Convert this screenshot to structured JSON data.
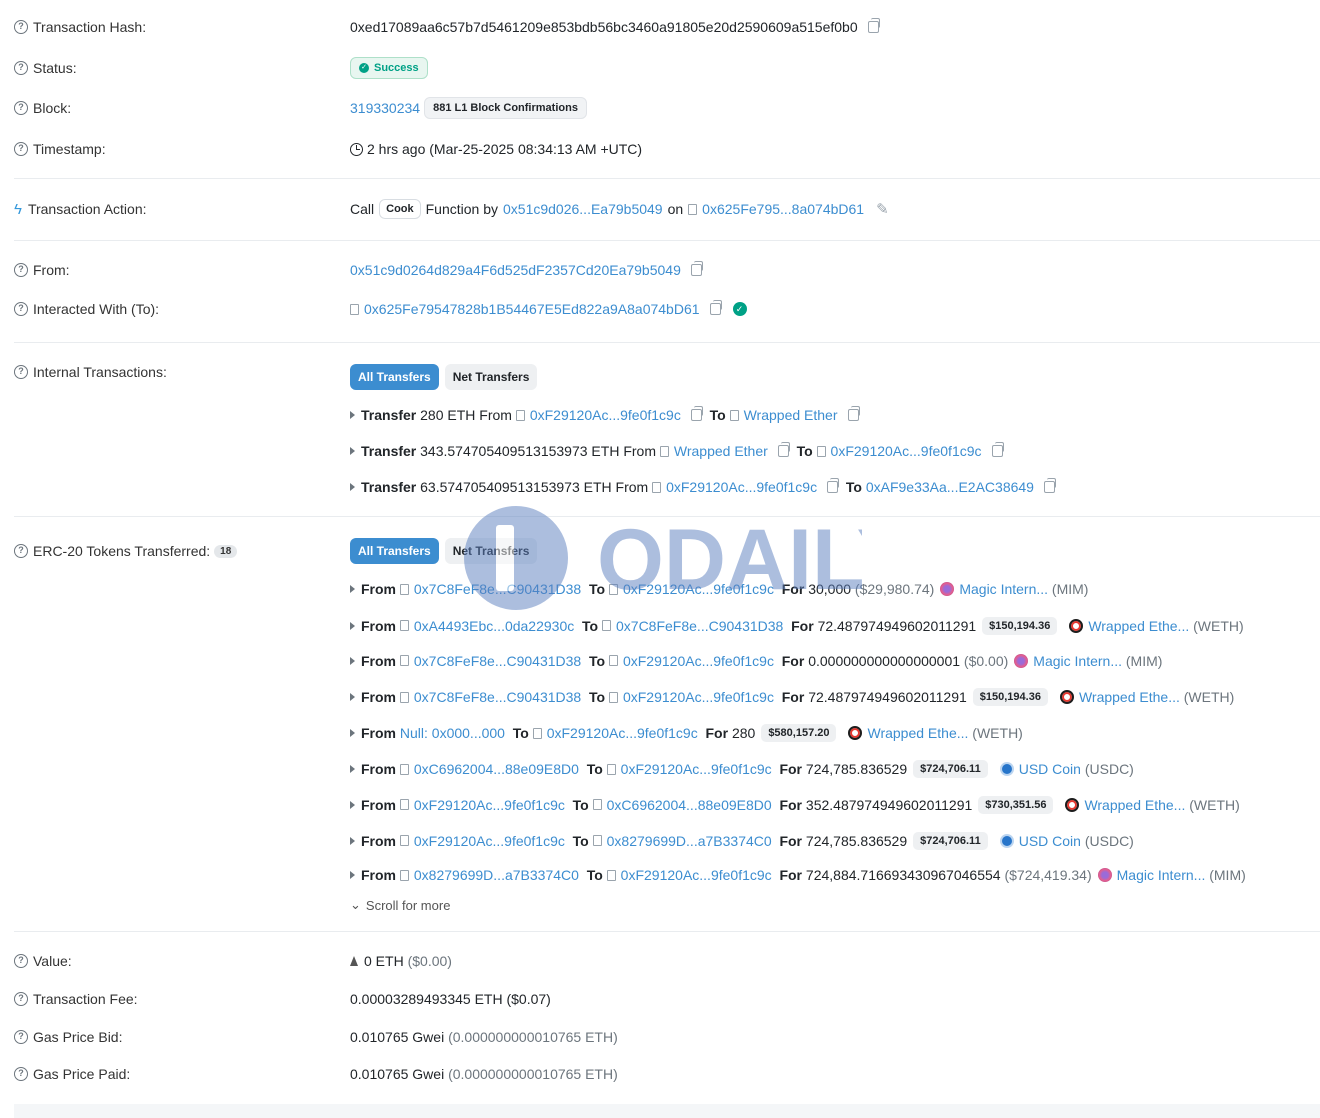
{
  "tx_hash": {
    "label": "Transaction Hash:",
    "value": "0xed17089aa6c57b7d5461209e853bdb56bc3460a91805e20d2590609a515ef0b0"
  },
  "status": {
    "label": "Status:",
    "value": "Success"
  },
  "block": {
    "label": "Block:",
    "number": "319330234",
    "confirmations": "881 L1 Block Confirmations"
  },
  "timestamp": {
    "label": "Timestamp:",
    "value": "2 hrs ago (Mar-25-2025 08:34:13 AM +UTC)"
  },
  "action": {
    "label": "Transaction Action:",
    "call": "Call",
    "method": "Cook",
    "function_by": "Function by",
    "from": "0x51c9d026...Ea79b5049",
    "on": "on",
    "contract": "0x625Fe795...8a074bD61"
  },
  "from": {
    "label": "From:",
    "value": "0x51c9d0264d829a4F6d525dF2357Cd20Ea79b5049"
  },
  "to": {
    "label": "Interacted With (To):",
    "value": "0x625Fe79547828b1B54467E5Ed822a9A8a074bD61"
  },
  "internal": {
    "label": "Internal Transactions:",
    "tab_all": "All Transfers",
    "tab_net": "Net Transfers",
    "rows": [
      {
        "lead": "Transfer",
        "amount": "280 ETH From",
        "from": "0xF29120Ac...9fe0f1c9c",
        "to_label": "To",
        "to": "Wrapped Ether"
      },
      {
        "lead": "Transfer",
        "amount": "343.574705409513153973 ETH From",
        "from": "Wrapped Ether",
        "to_label": "To",
        "to": "0xF29120Ac...9fe0f1c9c"
      },
      {
        "lead": "Transfer",
        "amount": "63.574705409513153973 ETH From",
        "from": "0xF29120Ac...9fe0f1c9c",
        "to_label": "To",
        "to": "0xAF9e33Aa...E2AC38649"
      }
    ]
  },
  "erc20": {
    "label": "ERC-20 Tokens Transferred:",
    "count": "18",
    "tab_all": "All Transfers",
    "tab_net": "Net Transfers",
    "from_label": "From",
    "to_label": "To",
    "for_label": "For",
    "rows": [
      {
        "from": "0x7C8FeF8e...C90431D38",
        "to": "0xF29120Ac...9fe0f1c9c",
        "amount": "30,000",
        "usd": "($29,980.74)",
        "token": "Magic Intern...",
        "symbol": "(MIM)"
      },
      {
        "from": "0xA4493Ebc...0da22930c",
        "to": "0x7C8FeF8e...C90431D38",
        "amount": "72.487974949602011291",
        "usd": "$150,194.36",
        "token": "Wrapped Ethe...",
        "symbol": "(WETH)"
      },
      {
        "from": "0x7C8FeF8e...C90431D38",
        "to": "0xF29120Ac...9fe0f1c9c",
        "amount": "0.000000000000000001",
        "usd": "($0.00)",
        "token": "Magic Intern...",
        "symbol": "(MIM)"
      },
      {
        "from": "0x7C8FeF8e...C90431D38",
        "to": "0xF29120Ac...9fe0f1c9c",
        "amount": "72.487974949602011291",
        "usd": "$150,194.36",
        "token": "Wrapped Ethe...",
        "symbol": "(WETH)"
      },
      {
        "from": "Null: 0x000...000",
        "to": "0xF29120Ac...9fe0f1c9c",
        "amount": "280",
        "usd": "$580,157.20",
        "token": "Wrapped Ethe...",
        "symbol": "(WETH)"
      },
      {
        "from": "0xC6962004...88e09E8D0",
        "to": "0xF29120Ac...9fe0f1c9c",
        "amount": "724,785.836529",
        "usd": "$724,706.11",
        "token": "USD Coin",
        "symbol": "(USDC)"
      },
      {
        "from": "0xF29120Ac...9fe0f1c9c",
        "to": "0xC6962004...88e09E8D0",
        "amount": "352.487974949602011291",
        "usd": "$730,351.56",
        "token": "Wrapped Ethe...",
        "symbol": "(WETH)"
      },
      {
        "from": "0xF29120Ac...9fe0f1c9c",
        "to": "0x8279699D...a7B3374C0",
        "amount": "724,785.836529",
        "usd": "$724,706.11",
        "token": "USD Coin",
        "symbol": "(USDC)"
      },
      {
        "from": "0x8279699D...a7B3374C0",
        "to": "0xF29120Ac...9fe0f1c9c",
        "amount": "724,884.716693430967046554",
        "usd": "($724,419.34)",
        "token": "Magic Intern...",
        "symbol": "(MIM)"
      }
    ],
    "scroll_more": "Scroll for more"
  },
  "value": {
    "label": "Value:",
    "amount": "0 ETH",
    "usd": "($0.00)"
  },
  "fee": {
    "label": "Transaction Fee:",
    "value": "0.00003289493345 ETH ($0.07)"
  },
  "gas_bid": {
    "label": "Gas Price Bid:",
    "gwei": "0.010765 Gwei",
    "eth": "(0.000000000010765 ETH)"
  },
  "gas_paid": {
    "label": "Gas Price Paid:",
    "gwei": "0.010765 Gwei",
    "eth": "(0.000000000010765 ETH)"
  },
  "watermark": {
    "text": "ODAILY"
  },
  "colors": {
    "link": "#3c8dd0",
    "success": "#00a186",
    "divider": "#e9ecef"
  }
}
